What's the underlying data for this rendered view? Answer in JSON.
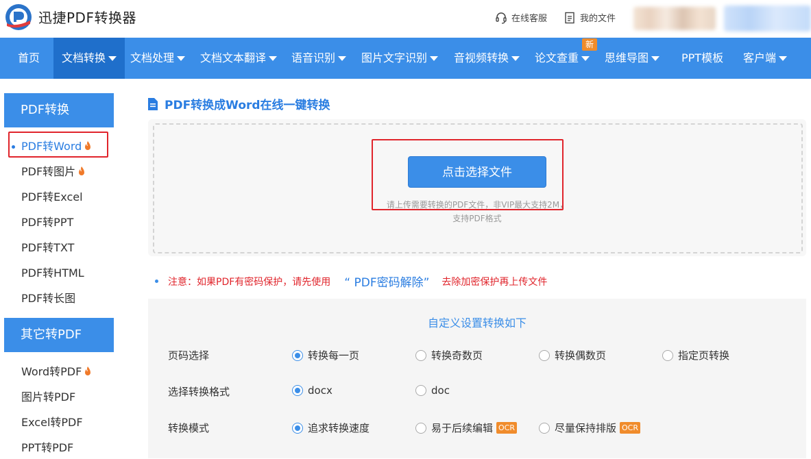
{
  "header": {
    "brand": "迅捷PDF转换器",
    "service_label": "在线客服",
    "files_label": "我的文件"
  },
  "nav": {
    "items": [
      {
        "label": "首页"
      },
      {
        "label": "文档转换"
      },
      {
        "label": "文档处理"
      },
      {
        "label": "文档文本翻译"
      },
      {
        "label": "语音识别"
      },
      {
        "label": "图片文字识别"
      },
      {
        "label": "音视频转换"
      },
      {
        "label": "论文查重"
      },
      {
        "label": "思维导图"
      },
      {
        "label": "PPT模板"
      },
      {
        "label": "客户端"
      }
    ],
    "new_badge": "新"
  },
  "sidebar": {
    "group1_title": "PDF转换",
    "group1_items": [
      {
        "label": "PDF转Word"
      },
      {
        "label": "PDF转图片"
      },
      {
        "label": "PDF转Excel"
      },
      {
        "label": "PDF转PPT"
      },
      {
        "label": "PDF转TXT"
      },
      {
        "label": "PDF转HTML"
      },
      {
        "label": "PDF转长图"
      }
    ],
    "group2_title": "其它转PDF",
    "group2_items": [
      {
        "label": "Word转PDF"
      },
      {
        "label": "图片转PDF"
      },
      {
        "label": "Excel转PDF"
      },
      {
        "label": "PPT转PDF"
      }
    ]
  },
  "main": {
    "title": "PDF转换成Word在线一键转换",
    "choose_button": "点击选择文件",
    "hint_line1": "请上传需要转换的PDF文件，非VIP最大支持2M，",
    "hint_line2": "支持PDF格式",
    "notice_prefix": "注意：如果PDF有密码保护，请先使用",
    "notice_link": "“ PDF密码解除”",
    "notice_suffix": "去除加密保护再上传文件"
  },
  "settings": {
    "title": "自定义设置转换如下",
    "page_label": "页码选择",
    "page_options": [
      "转换每一页",
      "转换奇数页",
      "转换偶数页",
      "指定页转换"
    ],
    "format_label": "选择转换格式",
    "format_options": [
      "docx",
      "doc"
    ],
    "mode_label": "转换模式",
    "mode_options": [
      "追求转换速度",
      "易于后续编辑",
      "尽量保持排版"
    ],
    "ocr_badge": "OCR"
  },
  "colors": {
    "primary": "#3b8ee8",
    "nav_active": "#1f6fcb",
    "highlight_box": "#e0242b",
    "badge_orange": "#f08c2c"
  }
}
